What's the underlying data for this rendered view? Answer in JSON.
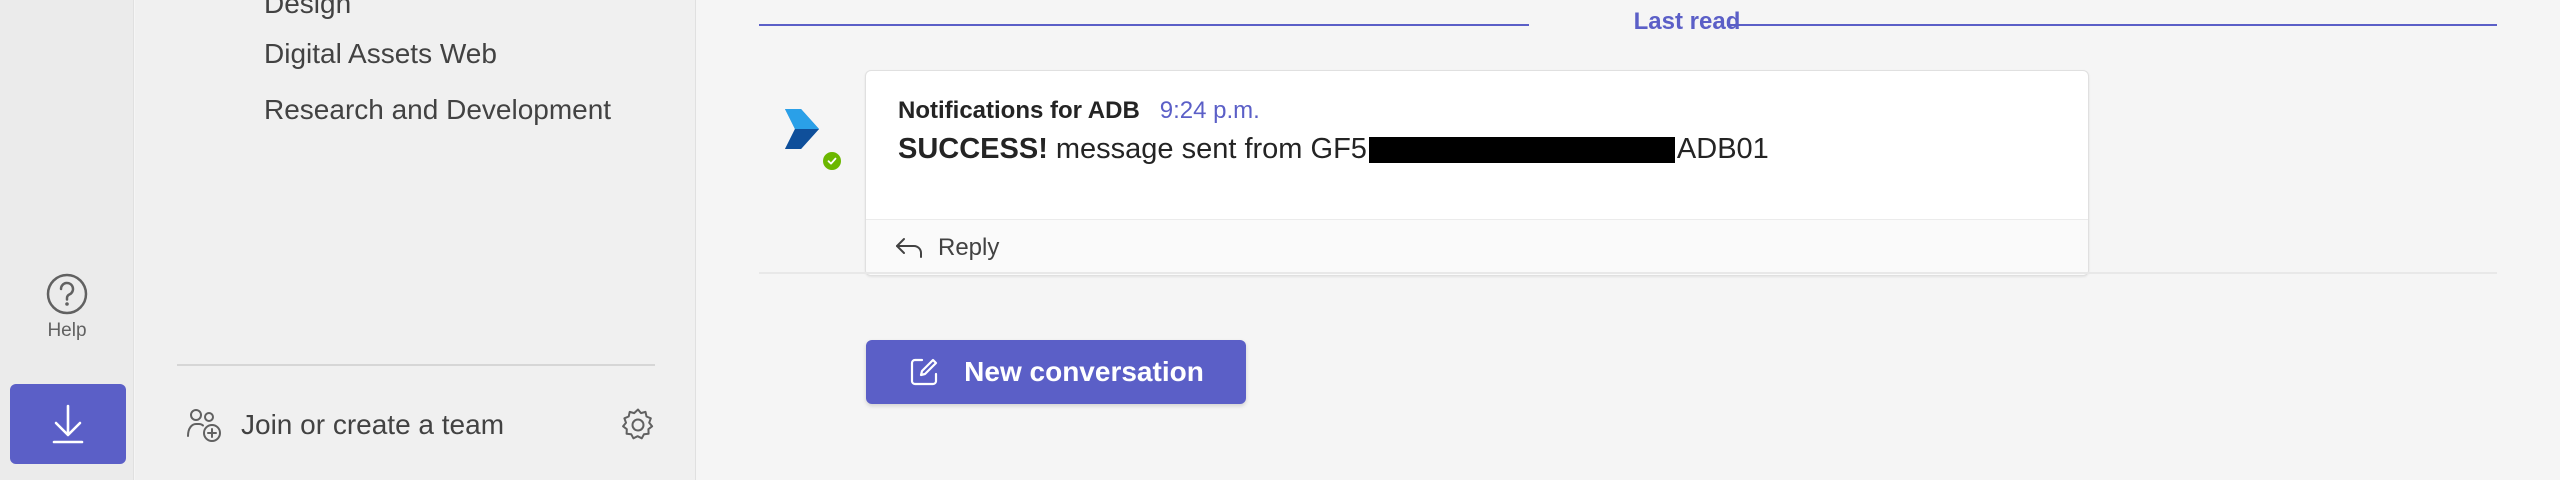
{
  "rail": {
    "help_label": "Help",
    "accent_color": "#5b5fc7"
  },
  "teams_panel": {
    "items": [
      {
        "label": "Design"
      },
      {
        "label": "Digital Assets Web"
      },
      {
        "label": "Research and Development"
      }
    ],
    "join_label": "Join or create a team"
  },
  "chat": {
    "last_read_label": "Last read",
    "message": {
      "sender": "Notifications for ADB",
      "time": "9:24 p.m.",
      "status_word": "SUCCESS!",
      "text_before": "message sent from GF5",
      "text_after": "ADB01",
      "presence_color": "#6bb700"
    },
    "reply_label": "Reply",
    "new_conversation_label": "New conversation"
  }
}
